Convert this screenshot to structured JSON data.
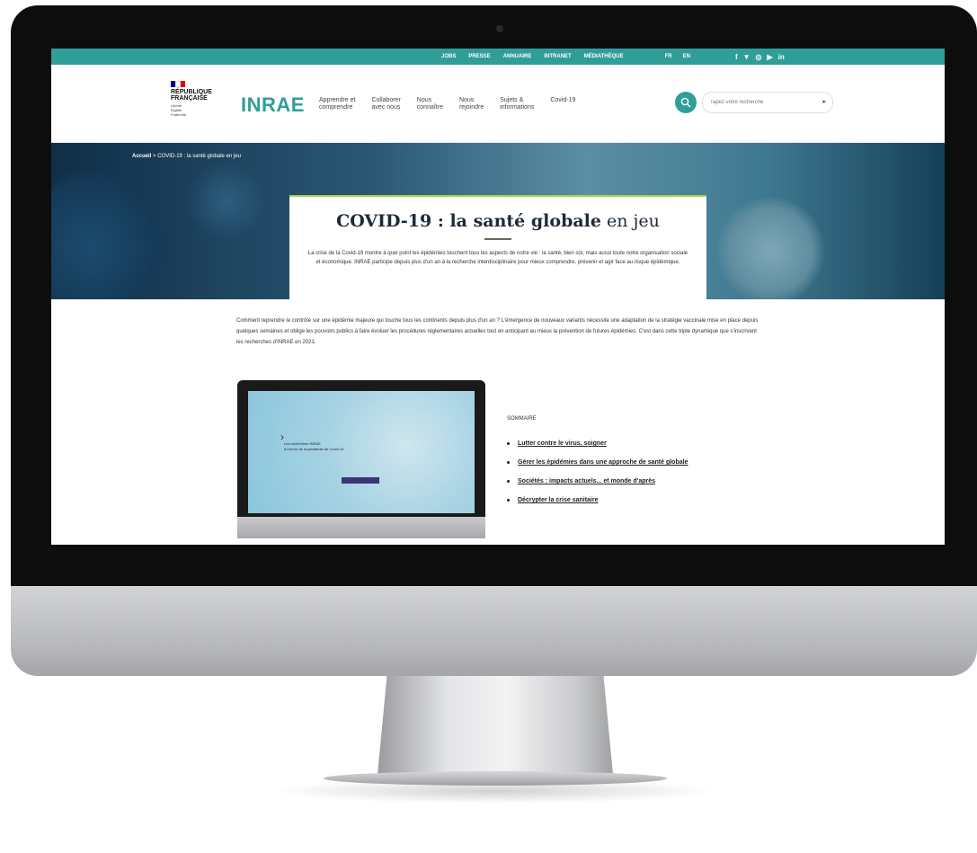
{
  "topbar": {
    "links": [
      "JOBS",
      "PRESSE",
      "ANNUAIRE",
      "INTRANET",
      "MÉDIATHÈQUE"
    ],
    "languages": [
      "FR",
      "EN"
    ],
    "social_icons": [
      "facebook-icon",
      "twitter-icon",
      "instagram-icon",
      "youtube-icon",
      "linkedin-icon"
    ]
  },
  "header": {
    "republique": {
      "name": "RÉPUBLIQUE\nFRANÇAISE",
      "motto": "Liberté\nÉgalité\nFraternité",
      "flag_colors": [
        "#000091",
        "#ffffff",
        "#e1000f"
      ]
    },
    "logo": "INRAE",
    "nav": [
      "Apprendre et\ncomprendre",
      "Collaborer\navec nous",
      "Nous\nconnaître",
      "Nous\nrejoindre",
      "Sujets &\ninformations",
      "Covid-19"
    ],
    "search": {
      "placeholder": "Tapez votre recherche",
      "icon": "search-icon"
    }
  },
  "hero": {
    "breadcrumb": {
      "home": "Accueil",
      "separator": " > ",
      "current": "COVID-19 : la santé globale en jeu"
    },
    "title_bold": "COVID-19 : la santé globale",
    "title_light": "en jeu",
    "intro": "La crise de la Covid-19 montre à quel point les épidémies touchent tous les aspects de notre vie : la santé, bien sûr, mais aussi toute notre organisation sociale et économique. INRAE participe depuis plus d'un an à la recherche interdisciplinaire pour mieux comprendre, prévenir et agir face au risque épidémique."
  },
  "main": {
    "intro": "Comment reprendre le contrôle sur une épidémie majeure qui touche tous les continents depuis plus d'un an ? L'émergence de nouveaux variants nécessite une adaptation de la stratégie vaccinale mise en place depuis quelques semaines et oblige les pouvoirs publics à faire évoluer les procédures réglementaires actuelles tout en anticipant au mieux la prévention de futures épidémies. C'est dans cette triple dynamique que s'inscrivent les recherches d'INRAE en 2021.",
    "laptop_screen": {
      "text": "Les recherches INRAE\nà l'heure de la pandémie de Covid-19"
    },
    "sommaire_title": "SOMMAIRE",
    "toc": [
      "Lutter contre le virus, soigner",
      "Gérer les épidémies dans une approche de santé globale",
      "Sociétés : impacts actuels... et monde d'après",
      "Décrypter la crise sanitaire"
    ]
  },
  "colors": {
    "accent": "#2f9e99",
    "accent_green": "#a8d24a",
    "dark_text": "#1e2a3a"
  }
}
